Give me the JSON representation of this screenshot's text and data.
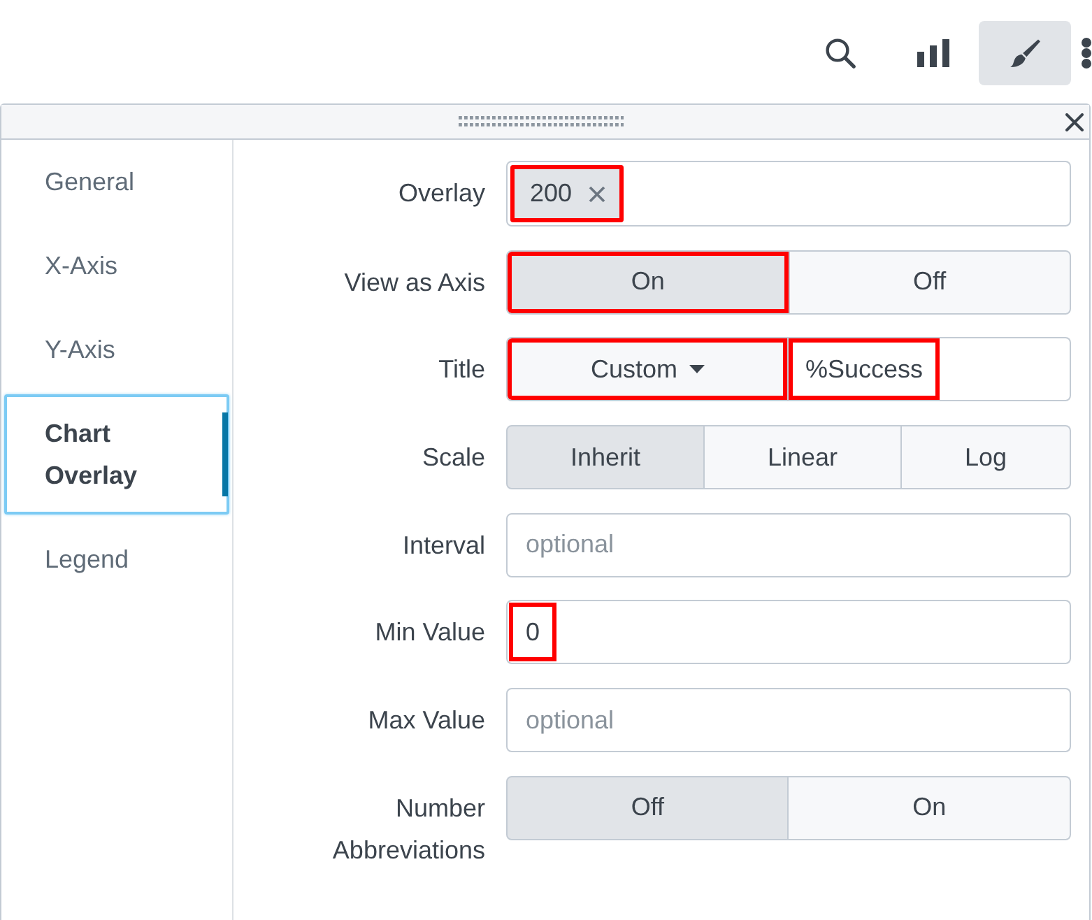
{
  "toolbar": {
    "buttons": [
      {
        "selected": false
      },
      {
        "selected": false
      },
      {
        "selected": true
      }
    ]
  },
  "sidebar": {
    "items": [
      {
        "label": "General",
        "selected": false
      },
      {
        "label": "X-Axis",
        "selected": false
      },
      {
        "label": "Y-Axis",
        "selected": false
      },
      {
        "label": "Chart Overlay",
        "selected": true
      },
      {
        "label": "Legend",
        "selected": false
      }
    ]
  },
  "form": {
    "rows": [
      {
        "kind": "multiselect",
        "label": "Overlay",
        "tags": [
          {
            "text": "200",
            "highlighted": true
          }
        ]
      },
      {
        "kind": "toggle",
        "label": "View as Axis",
        "options": [
          {
            "label": "On",
            "selected": true,
            "highlighted": true
          },
          {
            "label": "Off",
            "selected": false,
            "highlighted": false
          }
        ]
      },
      {
        "kind": "dropdown_text",
        "label": "Title",
        "dropdown": {
          "label": "Custom",
          "highlighted": true
        },
        "input": {
          "value": "%Success",
          "highlighted": true
        }
      },
      {
        "kind": "toggle",
        "label": "Scale",
        "options": [
          {
            "label": "Inherit",
            "selected": true,
            "highlighted": false
          },
          {
            "label": "Linear",
            "selected": false,
            "highlighted": false
          },
          {
            "label": "Log",
            "selected": false,
            "highlighted": false
          }
        ]
      },
      {
        "kind": "text",
        "label": "Interval",
        "placeholder": "optional"
      },
      {
        "kind": "text",
        "label": "Min Value",
        "value": "0",
        "highlighted": true
      },
      {
        "kind": "text",
        "label": "Max Value",
        "placeholder": "optional"
      },
      {
        "kind": "toggle",
        "label": "Number Abbreviations",
        "options": [
          {
            "label": "Off",
            "selected": true,
            "highlighted": false
          },
          {
            "label": "On",
            "selected": false,
            "highlighted": false
          }
        ]
      }
    ]
  }
}
